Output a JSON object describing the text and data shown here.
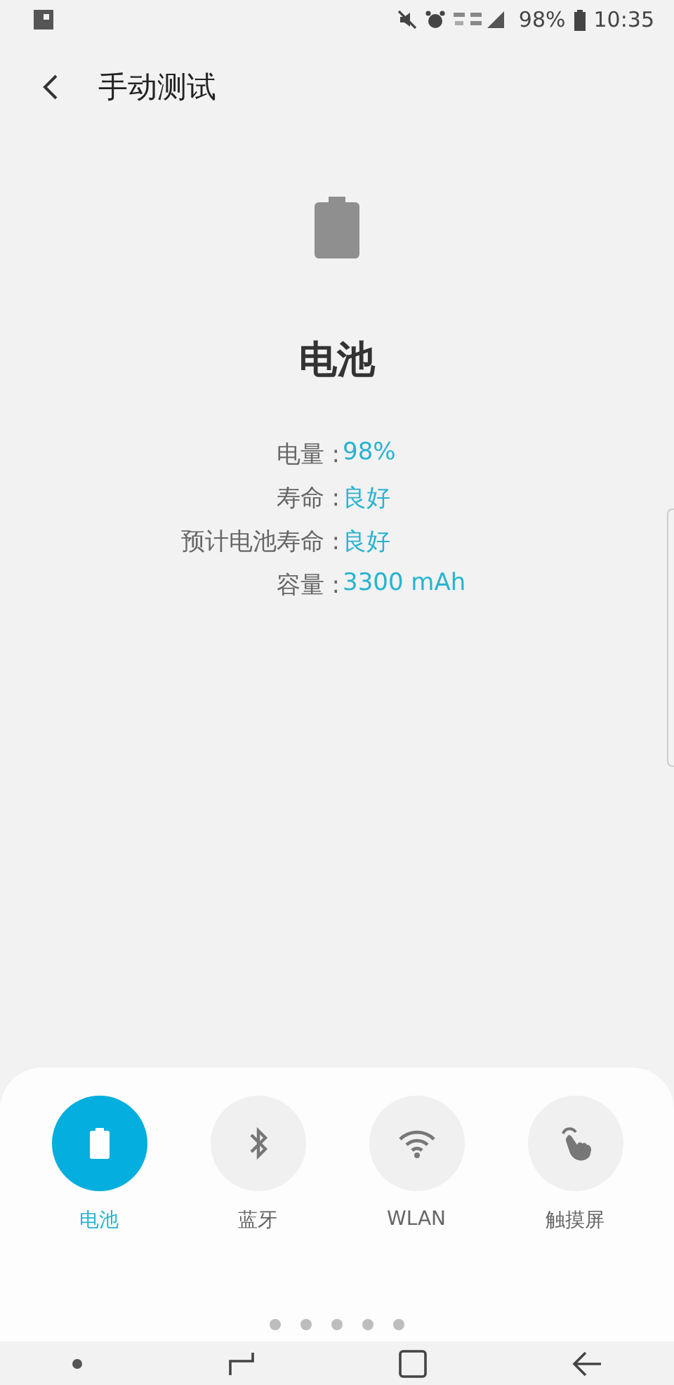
{
  "status_bar": {
    "battery": "98%",
    "time": "10:35"
  },
  "header": {
    "title": "手动测试"
  },
  "battery_panel": {
    "title": "电池",
    "rows": [
      {
        "label": "电量 :",
        "value": "98%"
      },
      {
        "label": "寿命 :",
        "value": "良好"
      },
      {
        "label": "预计电池寿命 :",
        "value": "良好"
      },
      {
        "label": "容量 :",
        "value": "3300 mAh"
      }
    ]
  },
  "tests": [
    {
      "kind": "battery",
      "label": "电池",
      "selected": true
    },
    {
      "kind": "bluetooth",
      "label": "蓝牙",
      "selected": false
    },
    {
      "kind": "wifi",
      "label": "WLAN",
      "selected": false
    },
    {
      "kind": "touch",
      "label": "触摸屏",
      "selected": false
    }
  ],
  "pager": [
    {
      "selected": false
    },
    {
      "selected": false
    },
    {
      "selected": false
    },
    {
      "selected": false
    },
    {
      "selected": false
    }
  ]
}
